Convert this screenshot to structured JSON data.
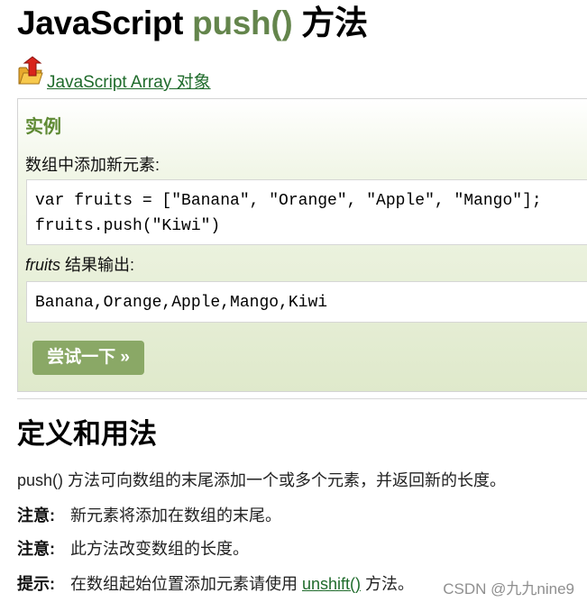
{
  "header": {
    "title_prefix": "JavaScript ",
    "title_method": "push()",
    "title_suffix": " 方法"
  },
  "array_link": {
    "icon": "folder-up-icon",
    "label": " JavaScript Array 对象"
  },
  "example": {
    "heading": "实例",
    "description": "数组中添加新元素:",
    "code_lines": [
      "var fruits = [\"Banana\", \"Orange\", \"Apple\", \"Mango\"];",
      "fruits.push(\"Kiwi\")"
    ],
    "result_var": "fruits",
    "result_label": " 结果输出:",
    "output": "Banana,Orange,Apple,Mango,Kiwi",
    "try_button": "尝试一下 »"
  },
  "definition": {
    "heading": "定义和用法",
    "paragraph": "push() 方法可向数组的末尾添加一个或多个元素，并返回新的长度。",
    "note1_label": "注意:",
    "note1_text": "新元素将添加在数组的末尾。",
    "note2_label": "注意:",
    "note2_text": "此方法改变数组的长度。",
    "tip_label": "提示:",
    "tip_text_before": "在数组起始位置添加元素请使用 ",
    "tip_link": "unshift()",
    "tip_text_after": " 方法。"
  },
  "watermark": "CSDN @九九nine9",
  "colors": {
    "accent_green": "#64854c",
    "link_green": "#1f6b2b",
    "button_green": "#8aa866",
    "heading_green": "#5f8a34"
  }
}
